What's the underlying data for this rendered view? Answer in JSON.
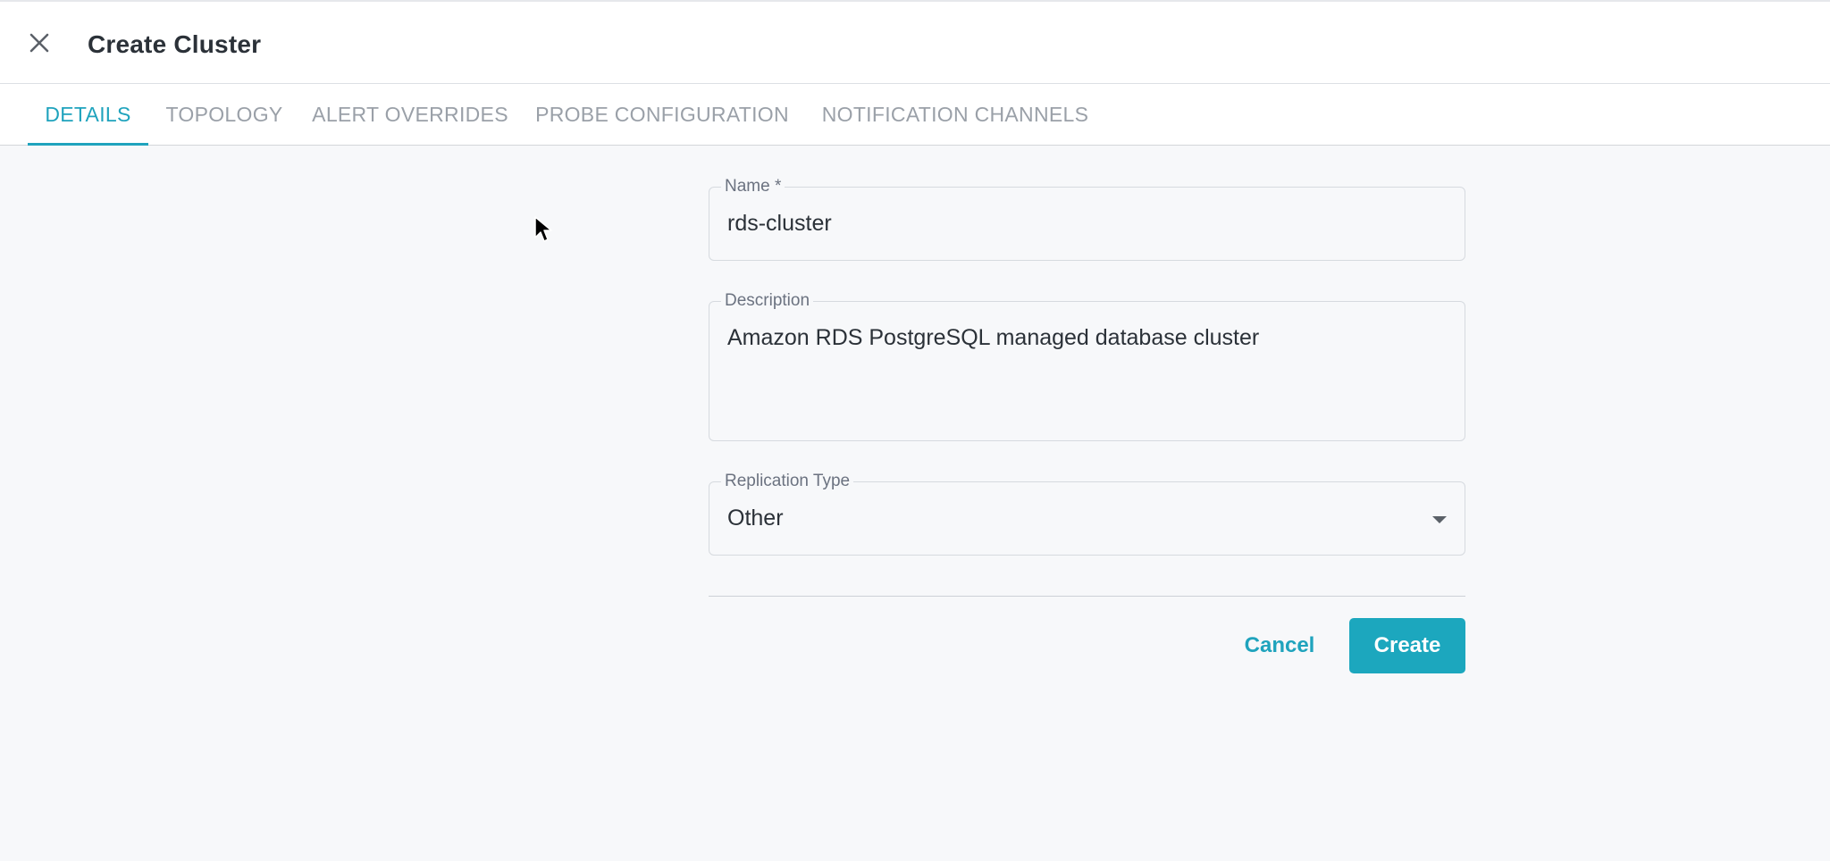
{
  "header": {
    "title": "Create Cluster",
    "close_icon": "close-icon"
  },
  "tabs": [
    {
      "label": "DETAILS",
      "active": true
    },
    {
      "label": "TOPOLOGY",
      "active": false
    },
    {
      "label": "ALERT OVERRIDES",
      "active": false
    },
    {
      "label": "PROBE CONFIGURATION",
      "active": false
    },
    {
      "label": "NOTIFICATION CHANNELS",
      "active": false
    }
  ],
  "form": {
    "name": {
      "label": "Name *",
      "value": "rds-cluster"
    },
    "description": {
      "label": "Description",
      "value": "Amazon RDS PostgreSQL managed database cluster"
    },
    "replication_type": {
      "label": "Replication Type",
      "value": "Other",
      "icon": "chevron-down-icon"
    }
  },
  "actions": {
    "cancel_label": "Cancel",
    "create_label": "Create"
  },
  "colors": {
    "accent": "#1fa3bd",
    "background": "#f7f8fa"
  }
}
